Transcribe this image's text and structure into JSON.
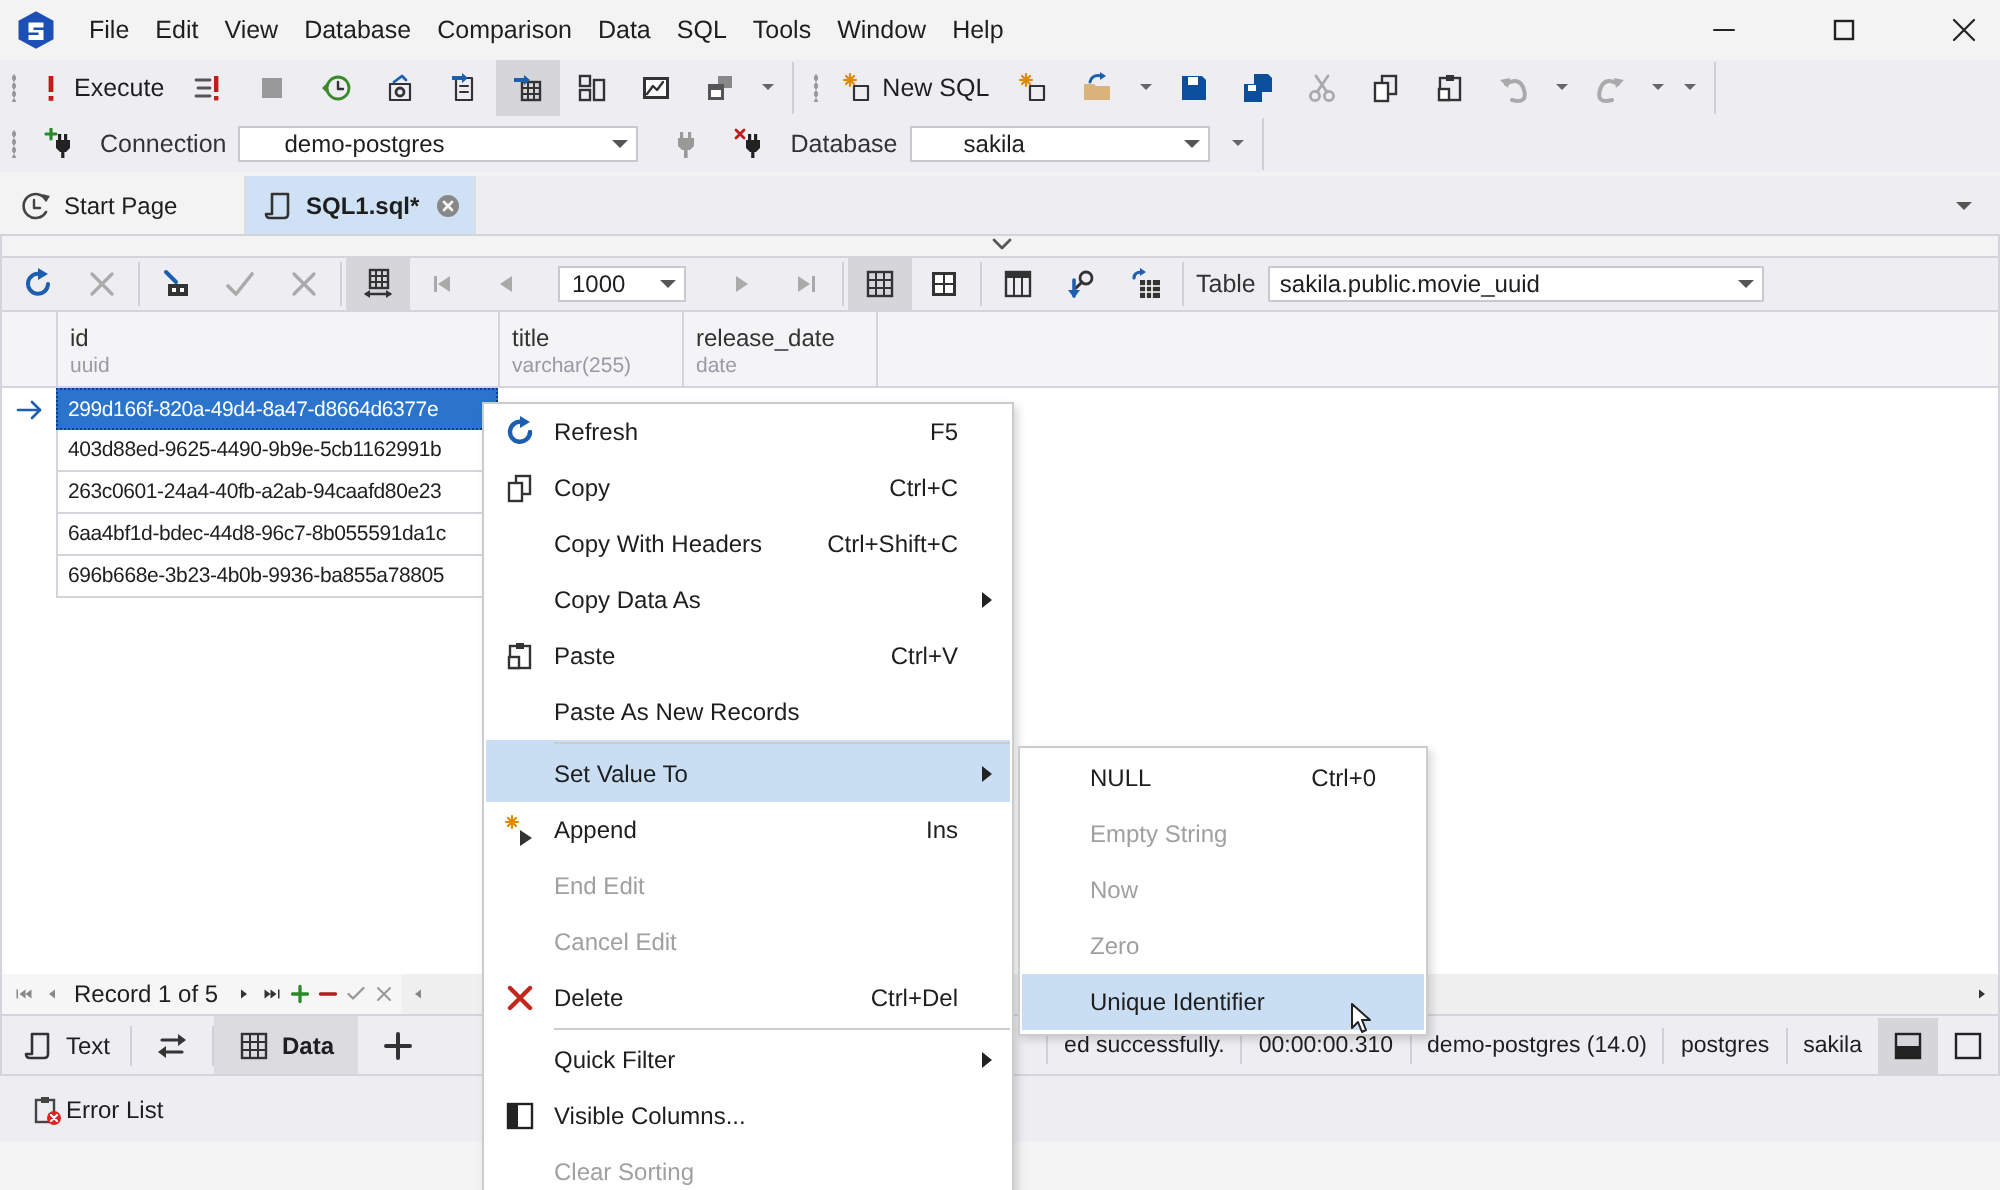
{
  "menu": [
    "File",
    "Edit",
    "View",
    "Database",
    "Comparison",
    "Data",
    "SQL",
    "Tools",
    "Window",
    "Help"
  ],
  "toolbar": {
    "execute": "Execute",
    "new_sql": "New SQL"
  },
  "connection_bar": {
    "connection_label": "Connection",
    "connection": "demo-postgres",
    "database_label": "Database",
    "database": "sakila"
  },
  "doc_tabs": [
    {
      "label": "Start Page",
      "selected": false
    },
    {
      "label": "SQL1.sql*",
      "selected": true
    }
  ],
  "grid_toolbar": {
    "page_size": "1000",
    "table_label": "Table",
    "table": "sakila.public.movie_uuid"
  },
  "table": {
    "columns": [
      {
        "name": "id",
        "type": "uuid"
      },
      {
        "name": "title",
        "type": "varchar(255)"
      },
      {
        "name": "release_date",
        "type": "date"
      }
    ],
    "rows": [
      {
        "id": "299d166f-820a-49d4-8a47-d8664d6377e",
        "selected": true
      },
      {
        "id": "403d88ed-9625-4490-9b9e-5cb1162991b",
        "selected": false
      },
      {
        "id": "263c0601-24a4-40fb-a2ab-94caafd80e23",
        "selected": false
      },
      {
        "id": "6aa4bf1d-bdec-44d8-96c7-8b055591da1c",
        "selected": false
      },
      {
        "id": "696b668e-3b23-4b0b-9936-ba855a78805",
        "selected": false
      }
    ]
  },
  "navigator": {
    "record": "Record 1 of 5"
  },
  "view_tabs": [
    {
      "label": "Text",
      "selected": false
    },
    {
      "label": "Data",
      "selected": true
    }
  ],
  "status": [
    "ed successfully.",
    "00:00:00.310",
    "demo-postgres (14.0)",
    "postgres",
    "sakila"
  ],
  "bottom_panel": {
    "error_list": "Error List"
  },
  "context_menu": [
    {
      "label": "Refresh",
      "shortcut": "F5",
      "disabled": false,
      "selected": false,
      "submenu": false,
      "separator_before": false
    },
    {
      "label": "Copy",
      "shortcut": "Ctrl+C",
      "disabled": false,
      "selected": false,
      "submenu": false,
      "separator_before": false
    },
    {
      "label": "Copy With Headers",
      "shortcut": "Ctrl+Shift+C",
      "disabled": false,
      "selected": false,
      "submenu": false,
      "separator_before": false
    },
    {
      "label": "Copy Data As",
      "disabled": false,
      "selected": false,
      "submenu": true,
      "separator_before": false
    },
    {
      "label": "Paste",
      "shortcut": "Ctrl+V",
      "disabled": false,
      "selected": false,
      "submenu": false,
      "separator_before": false
    },
    {
      "label": "Paste As New Records",
      "disabled": false,
      "selected": false,
      "submenu": false,
      "separator_before": false
    },
    {
      "label": "Set Value To",
      "disabled": false,
      "selected": true,
      "submenu": true,
      "separator_before": true
    },
    {
      "label": "Append",
      "shortcut": "Ins",
      "disabled": false,
      "selected": false,
      "submenu": false,
      "separator_before": false
    },
    {
      "label": "End Edit",
      "disabled": true,
      "selected": false,
      "submenu": false,
      "separator_before": false
    },
    {
      "label": "Cancel Edit",
      "disabled": true,
      "selected": false,
      "submenu": false,
      "separator_before": false
    },
    {
      "label": "Delete",
      "shortcut": "Ctrl+Del",
      "disabled": false,
      "selected": false,
      "submenu": false,
      "separator_before": false
    },
    {
      "label": "Quick Filter",
      "disabled": false,
      "selected": false,
      "submenu": true,
      "separator_before": true
    },
    {
      "label": "Visible Columns...",
      "disabled": false,
      "selected": false,
      "submenu": false,
      "separator_before": false
    },
    {
      "label": "Clear Sorting",
      "disabled": true,
      "selected": false,
      "submenu": false,
      "separator_before": false
    }
  ],
  "submenu": [
    {
      "label": "NULL",
      "shortcut": "Ctrl+0",
      "disabled": false,
      "selected": false
    },
    {
      "label": "Empty String",
      "disabled": true,
      "selected": false
    },
    {
      "label": "Now",
      "disabled": true,
      "selected": false
    },
    {
      "label": "Zero",
      "disabled": true,
      "selected": false
    },
    {
      "label": "Unique Identifier",
      "disabled": false,
      "selected": true
    }
  ]
}
